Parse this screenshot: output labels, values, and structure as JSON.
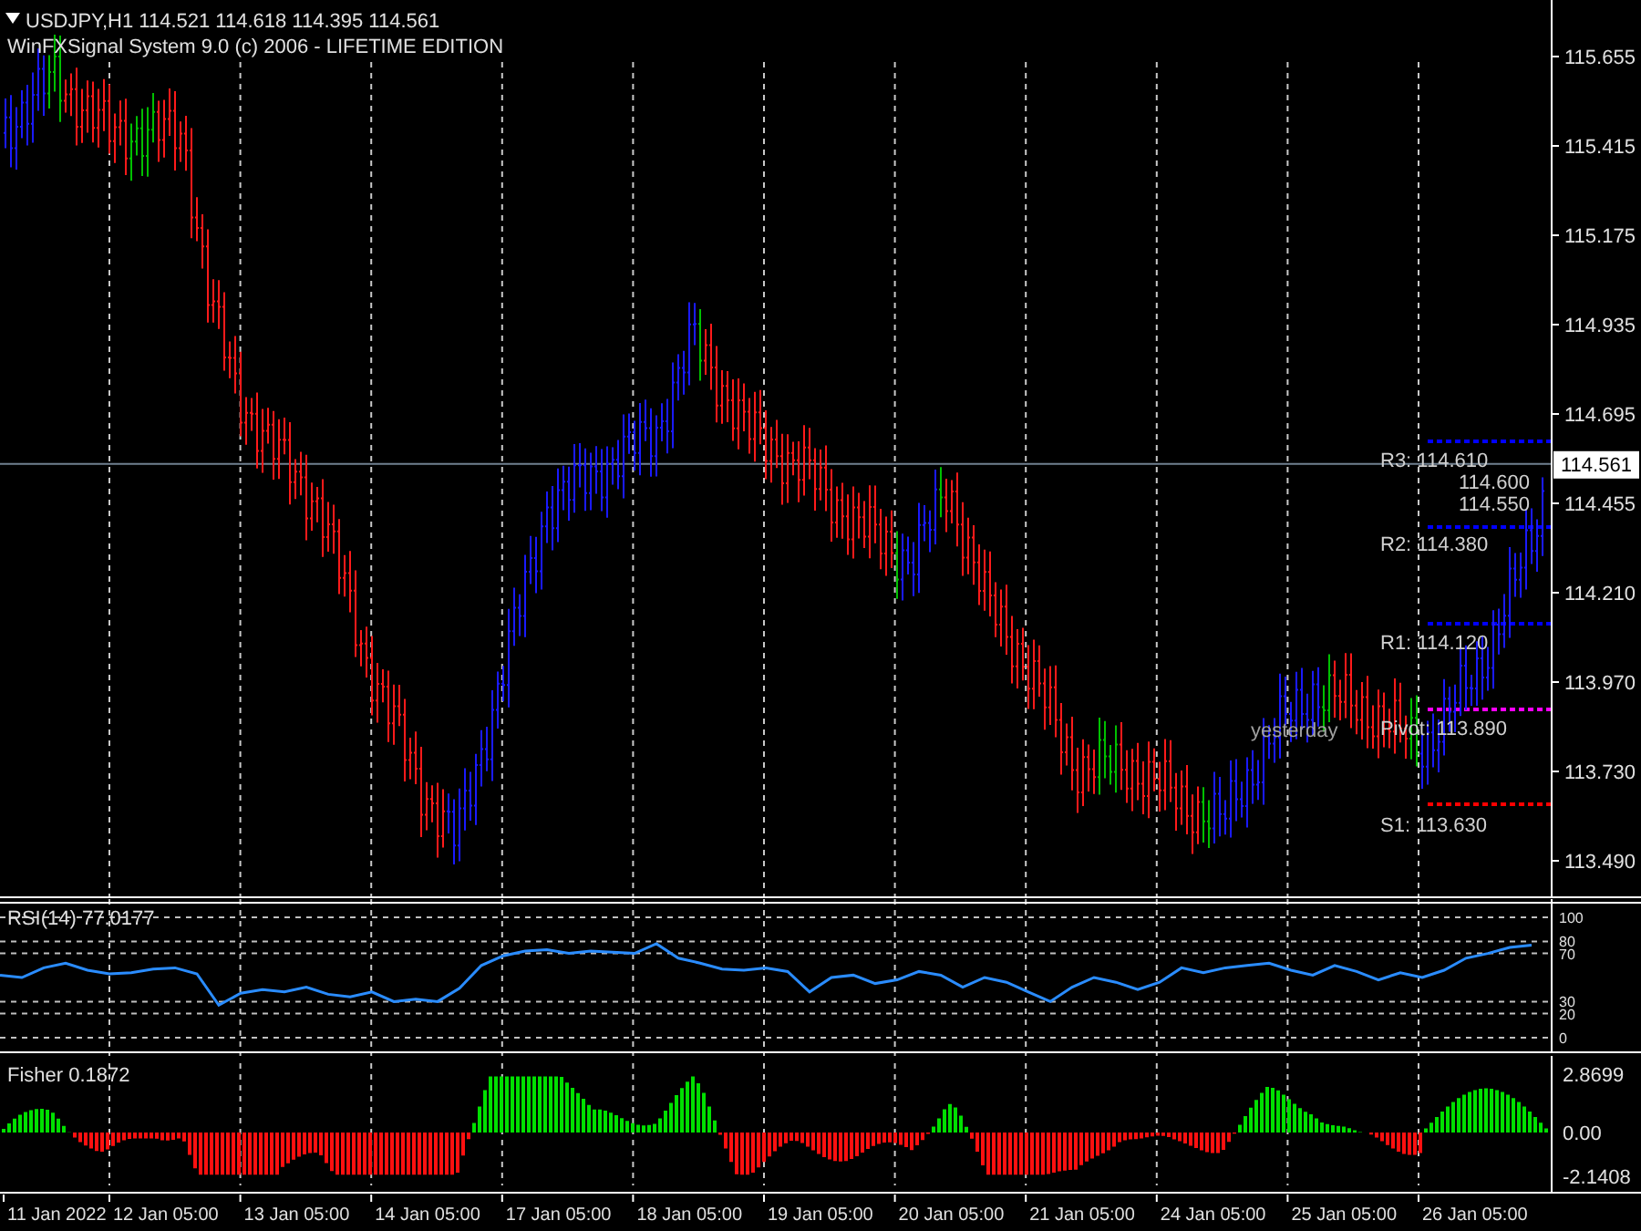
{
  "header": {
    "symbol_quote": "USDJPY,H1  114.521 114.618 114.395 114.561",
    "indicator_title": "WinFXSignal System 9.0 (c) 2006 - LIFETIME EDITION"
  },
  "price_chart": {
    "price_axis": [
      "115.655",
      "115.415",
      "115.175",
      "114.935",
      "114.695",
      "114.455",
      "114.210",
      "113.970",
      "113.730",
      "113.490"
    ],
    "current_price": "114.561",
    "levels": [
      {
        "label": "R3: 114.610",
        "color": "#0000ff"
      },
      {
        "label": "R2: 114.380",
        "color": "#0000ff"
      },
      {
        "label": "R1: 114.120",
        "color": "#0000ff"
      },
      {
        "label": "Pivot: 113.890",
        "color": "#ff00ff"
      },
      {
        "label": "S1: 113.630",
        "color": "#ff0000"
      }
    ],
    "extra_labels": [
      "114.600",
      "114.550"
    ],
    "session_label": "yesterday"
  },
  "rsi_panel": {
    "title": "RSI(14) 77.0177",
    "chart_data": {
      "type": "line",
      "ylim": [
        0,
        100
      ],
      "yticks": [
        0,
        20,
        30,
        70,
        80,
        100
      ],
      "grid": true,
      "series": [
        {
          "color": "#2a8cff",
          "values": [
            52,
            50,
            58,
            62,
            56,
            53,
            54,
            57,
            58,
            53,
            27,
            37,
            40,
            38,
            42,
            36,
            34,
            38,
            30,
            32,
            30,
            41,
            60,
            68,
            72,
            73,
            70,
            72,
            71,
            70,
            78,
            66,
            62,
            57,
            56,
            58,
            55,
            38,
            50,
            52,
            45,
            48,
            55,
            52,
            42,
            50,
            46,
            38,
            30,
            42,
            50,
            46,
            40,
            46,
            58,
            54,
            58,
            60,
            62,
            56,
            52,
            60,
            55,
            48,
            54,
            50,
            56,
            66,
            70,
            75,
            77
          ]
        }
      ]
    }
  },
  "fisher_panel": {
    "title": "Fisher 0.1872",
    "axis": [
      "2.8699",
      "0.00",
      "-2.1408"
    ]
  },
  "time_axis": [
    "11 Jan 2022",
    "12 Jan 05:00",
    "13 Jan 05:00",
    "14 Jan 05:00",
    "17 Jan 05:00",
    "18 Jan 05:00",
    "19 Jan 05:00",
    "20 Jan 05:00",
    "21 Jan 05:00",
    "24 Jan 05:00",
    "25 Jan 05:00",
    "26 Jan 05:00"
  ]
}
